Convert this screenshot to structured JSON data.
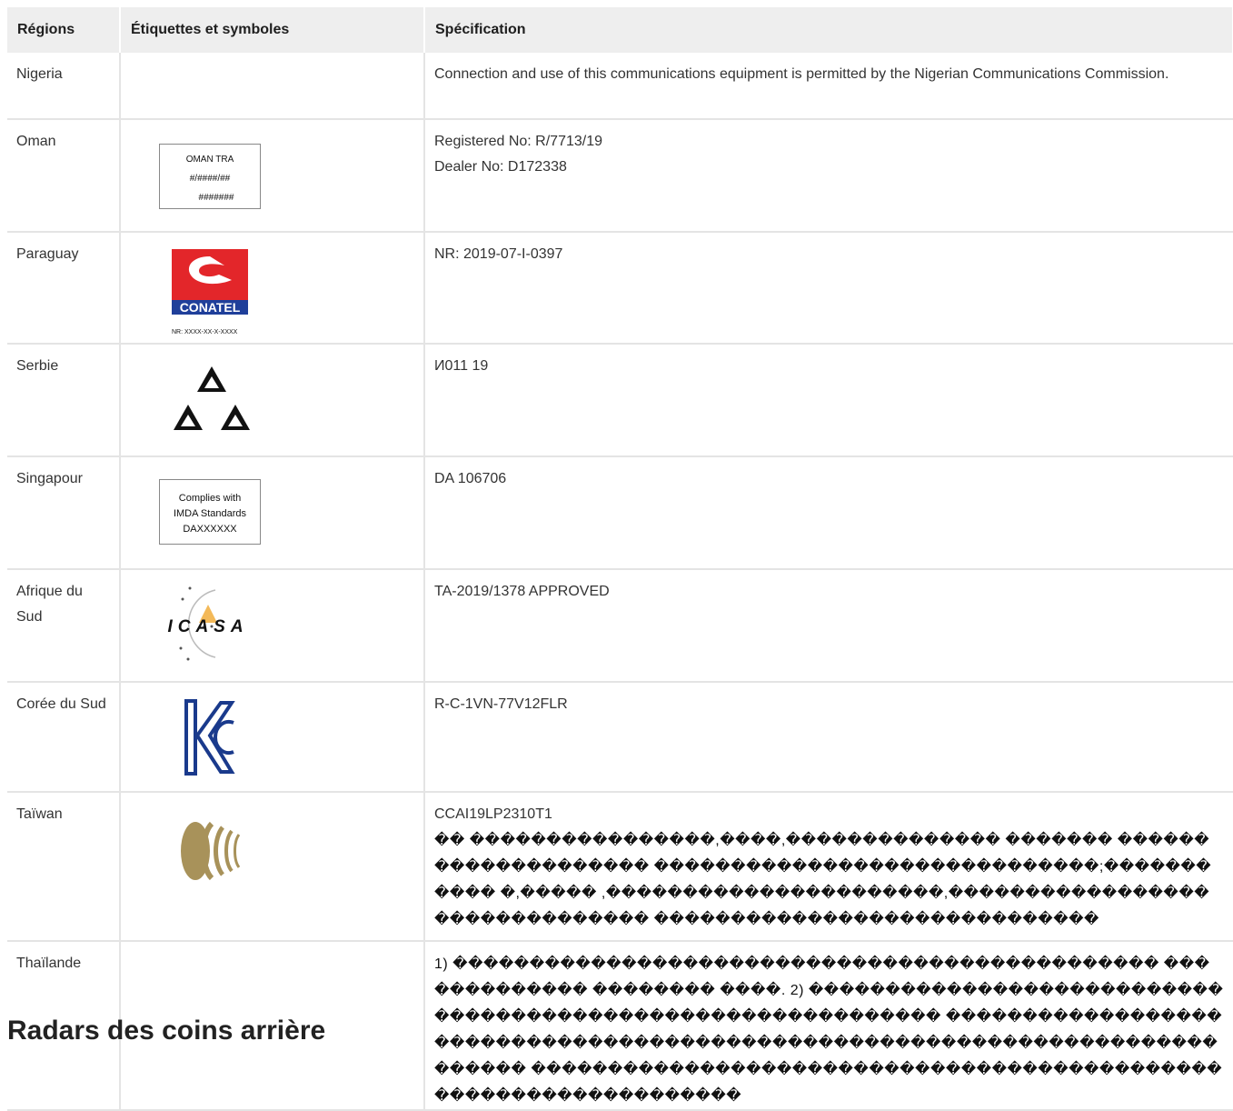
{
  "table": {
    "headers": [
      "Régions",
      "Étiquettes et symboles",
      "Spécification"
    ],
    "rows": [
      {
        "region": "Nigeria",
        "spec": [
          "Connection and use of this communications equipment is permitted by the Nigerian Communications Commission."
        ]
      },
      {
        "region": "Oman",
        "label_lines": [
          "OMAN TRA",
          "#/####/##",
          "#######"
        ],
        "spec": [
          "Registered No: R/7713/19",
          "Dealer No: D172338"
        ]
      },
      {
        "region": "Paraguay",
        "logo_text": "CONATEL",
        "logo_caption": "NR: XXXX-XX-X-XXXX",
        "spec": [
          "NR: 2019-07-I-0397"
        ]
      },
      {
        "region": "Serbie",
        "spec": [
          "И011 19"
        ]
      },
      {
        "region": "Singapour",
        "label_lines": [
          "Complies with",
          "IMDA Standards",
          "DAXXXXXX"
        ],
        "spec": [
          "DA 106706"
        ]
      },
      {
        "region": "Afrique du Sud",
        "logo_text": "ICASA",
        "spec": [
          "TA-2019/1378 APPROVED"
        ]
      },
      {
        "region": "Corée du Sud",
        "spec": [
          "R-C-1VN-77V12FLR"
        ]
      },
      {
        "region": "Taïwan",
        "spec": [
          "CCAI19LP2310T1"
        ],
        "garbled": "�� ����������������,����,�������������� ������� �������������������� �����������������������������;����������� �,����� ,����������������������,������������������������������� �����������������������������"
      },
      {
        "region": "Thaïlande",
        "spec": [
          "1) ���������������������������������������������� ������������� �������� ����. 2) ������������������������������������������������������������ ��������������������������������������������������������������������������� �����������������������������������������������������������������"
        ]
      }
    ]
  },
  "section_heading": "Radars des coins arrière",
  "colors": {
    "conatel_red": "#e3262a",
    "conatel_blue": "#1f3f9a",
    "kc_blue": "#1a3a8c",
    "ncc_gold": "#a8925a"
  }
}
